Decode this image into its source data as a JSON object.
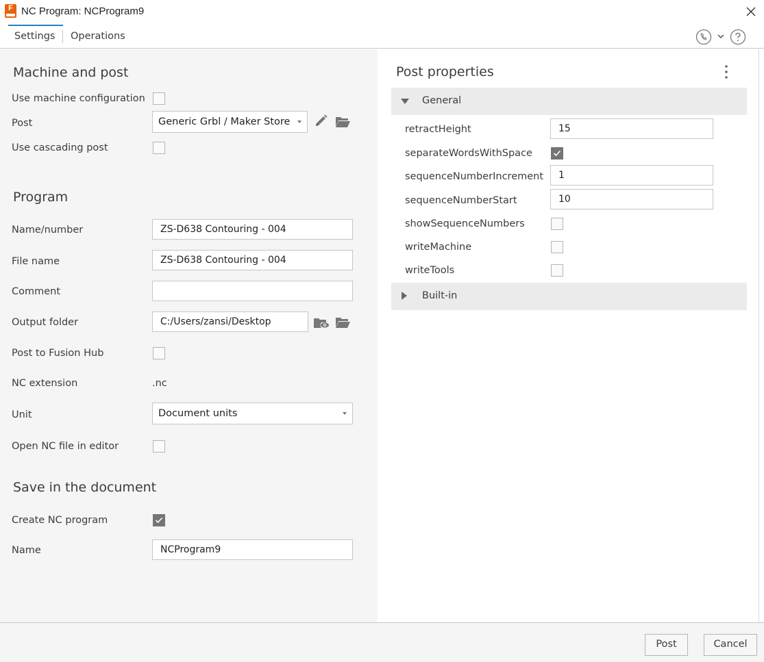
{
  "window": {
    "title": "NC Program: NCProgram9",
    "icon_letter": "F"
  },
  "tabs": [
    {
      "label": "Settings",
      "active": true
    },
    {
      "label": "Operations",
      "active": false
    }
  ],
  "header_icons": [
    "phone-icon",
    "chevron-down-icon",
    "help-icon"
  ],
  "machine_and_post": {
    "title": "Machine and post",
    "use_machine_configuration": {
      "label": "Use machine configuration",
      "checked": false
    },
    "post": {
      "label": "Post",
      "value": "Generic Grbl / Maker Store"
    },
    "use_cascading_post": {
      "label": "Use cascading post",
      "checked": false
    }
  },
  "program": {
    "title": "Program",
    "name_number": {
      "label": "Name/number",
      "value": "ZS-D638 Contouring - 004"
    },
    "file_name": {
      "label": "File name",
      "value": "ZS-D638 Contouring - 004"
    },
    "comment": {
      "label": "Comment",
      "value": ""
    },
    "output_folder": {
      "label": "Output folder",
      "value": "C:/Users/zansi/Desktop"
    },
    "post_to_fusion_hub": {
      "label": "Post to Fusion Hub",
      "checked": false
    },
    "nc_extension": {
      "label": "NC extension",
      "value": ".nc"
    },
    "unit": {
      "label": "Unit",
      "value": "Document units"
    },
    "open_nc_in_editor": {
      "label": "Open NC file in editor",
      "checked": false
    }
  },
  "save_in_document": {
    "title": "Save in the document",
    "create_nc_program": {
      "label": "Create NC program",
      "checked": true
    },
    "name": {
      "label": "Name",
      "value": "NCProgram9"
    }
  },
  "post_properties": {
    "title": "Post properties",
    "general": {
      "label": "General",
      "expanded": true,
      "retractHeight": {
        "label": "retractHeight",
        "value": "15"
      },
      "separateWordsWithSpace": {
        "label": "separateWordsWithSpace",
        "checked": true
      },
      "sequenceNumberIncrement": {
        "label": "sequenceNumberIncrement",
        "value": "1"
      },
      "sequenceNumberStart": {
        "label": "sequenceNumberStart",
        "value": "10"
      },
      "showSequenceNumbers": {
        "label": "showSequenceNumbers",
        "checked": false
      },
      "writeMachine": {
        "label": "writeMachine",
        "checked": false
      },
      "writeTools": {
        "label": "writeTools",
        "checked": false
      }
    },
    "built_in": {
      "label": "Built-in",
      "expanded": false
    }
  },
  "footer": {
    "post_label": "Post",
    "cancel_label": "Cancel"
  },
  "colors": {
    "accent": "#2a7fc0",
    "brand": "#e8620c",
    "panel_bg": "#f5f5f5",
    "checked_box": "#757575"
  }
}
